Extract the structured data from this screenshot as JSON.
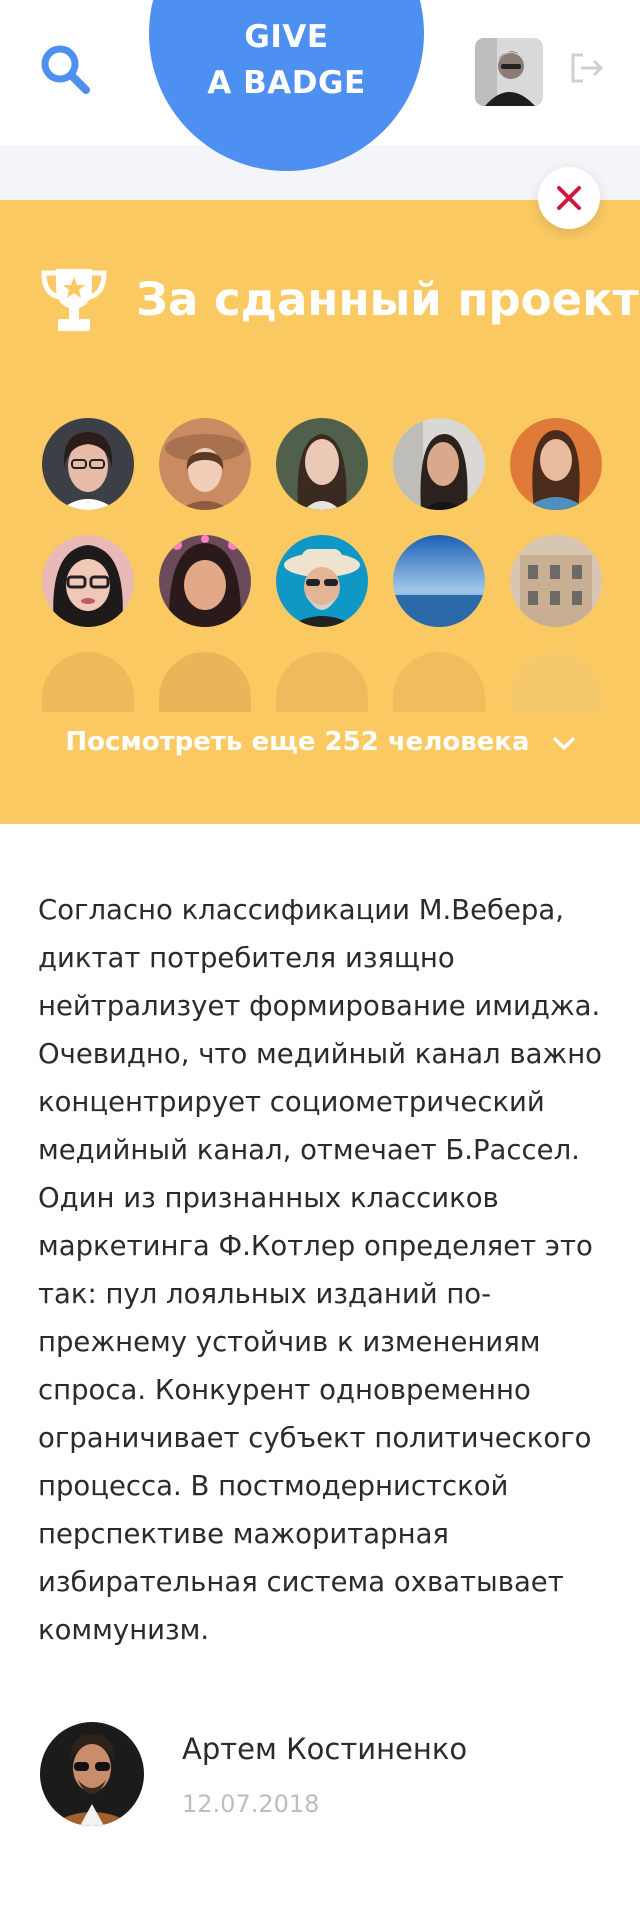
{
  "header": {
    "give_badge_line1": "GIVE",
    "give_badge_line2": "A BADGE",
    "accent_color": "#4e8ff2"
  },
  "badge_card": {
    "title": "За сданный проект",
    "background_color": "#fac962",
    "more_label": "Посмотреть еще 252 человека",
    "icons": [
      "trophy-icon",
      "close-icon",
      "chevron-down-icon",
      "search-icon",
      "logout-icon"
    ]
  },
  "description": "Согласно классификации М.Вебера, диктат потребителя изящно нейтрализует формирование имиджа. Очевидно, что медийный канал важно концентрирует социометрический медийный канал, отмечает Б.Рассел. Один из признанных классиков маркетинга Ф.Котлер определяет это так: пул лояльных изданий по-прежнему устойчив к изменениям спроса. Конкурент одновременно ограничивает субъект политического процесса. В постмодернистской перспективе мажоритарная избирательная система охватывает коммунизм.",
  "author": {
    "name": "Артем Костиненко",
    "date": "12.07.2018"
  }
}
